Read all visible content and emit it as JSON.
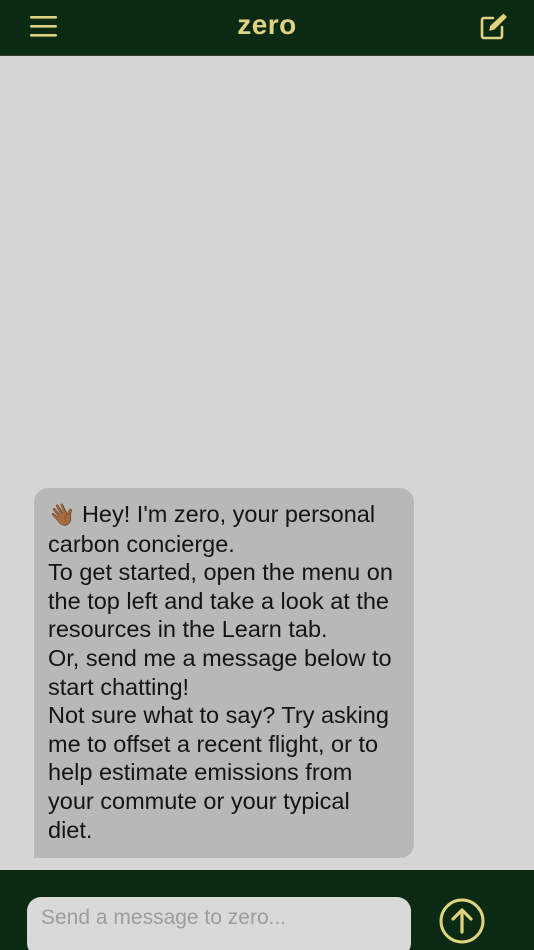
{
  "header": {
    "title": "zero",
    "menu_icon": "hamburger-menu-icon",
    "compose_icon": "compose-edit-icon"
  },
  "chat": {
    "messages": [
      {
        "sender": "zero",
        "emoji": "👋🏾",
        "lines": [
          "Hey! I'm zero, your personal carbon concierge.",
          "To get started, open the menu on the top left and take a look at the resources in the Learn tab.",
          "Or, send me a message below to start chatting!",
          "Not sure what to say? Try asking me to offset a recent flight, or to help estimate emissions from your commute or your typical diet."
        ]
      }
    ]
  },
  "composer": {
    "placeholder": "Send a message to zero...",
    "value": "",
    "send_icon": "arrow-up-circle-icon"
  },
  "colors": {
    "brand_dark": "#0b2a13",
    "accent": "#dfd37f",
    "chat_background": "#d6d6d6",
    "bubble_background": "#b8b8b6"
  }
}
